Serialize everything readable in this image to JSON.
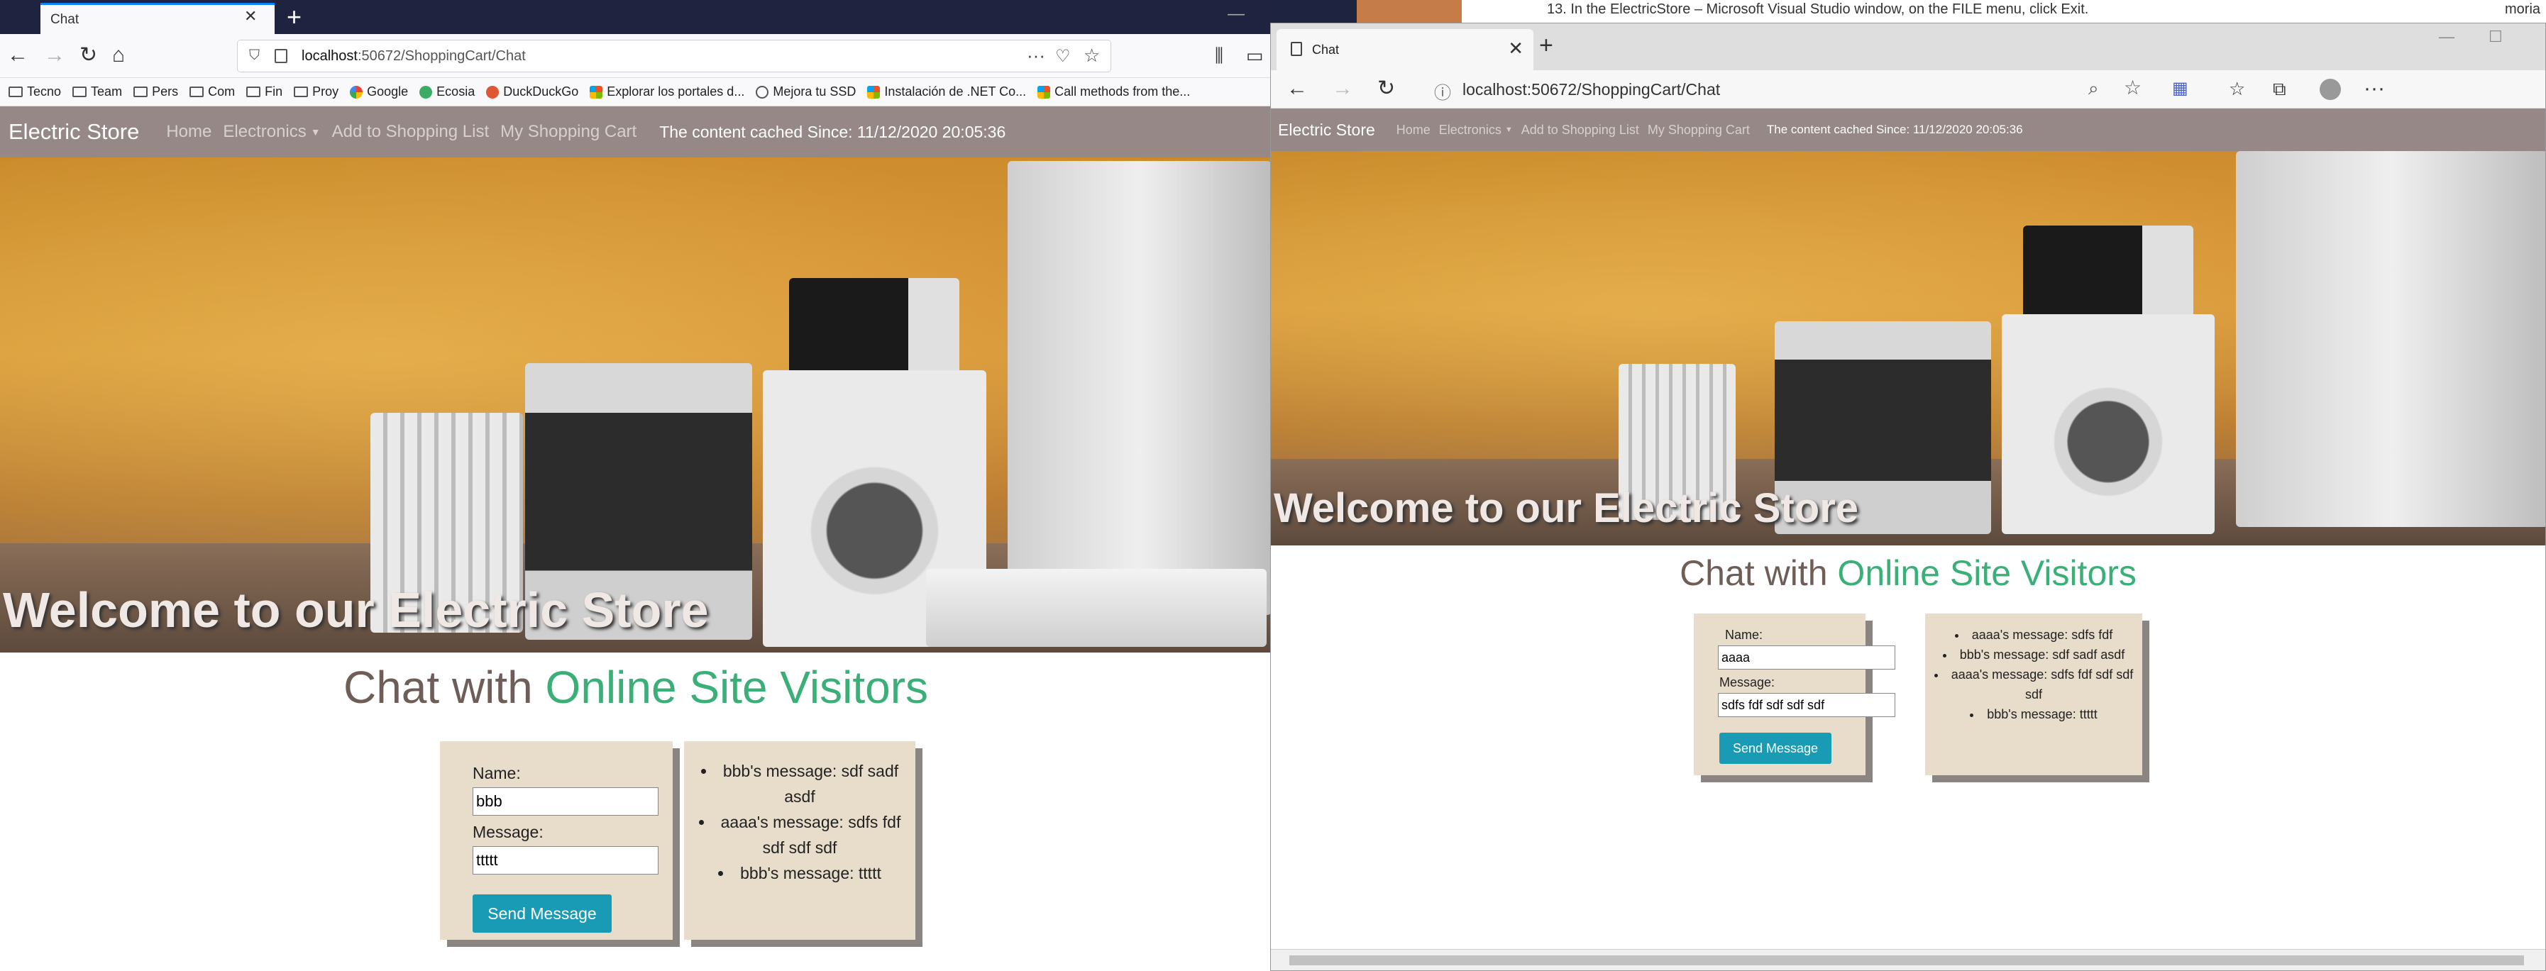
{
  "left": {
    "tab_title": "Chat",
    "url_host": "localhost",
    "url_path": ":50672/ShoppingCart/Chat",
    "bookmarks": [
      "Tecno",
      "Team",
      "Pers",
      "Com",
      "Fin",
      "Proy",
      "Google",
      "Ecosia",
      "DuckDuckGo",
      "Explorar los portales d...",
      "Mejora tu SSD",
      "Instalación de .NET Co...",
      "Call methods from the..."
    ],
    "site": {
      "brand": "Electric Store",
      "nav": [
        "Home",
        "Electronics",
        "Add to Shopping List",
        "My Shopping Cart"
      ],
      "cached": "The content cached Since: 11/12/2020 20:05:36",
      "welcome": "Welcome to our Electric Store",
      "chat_title_a": "Chat with",
      "chat_title_b": "Online Site Visitors",
      "name_label": "Name:",
      "name_value": "bbb",
      "message_label": "Message:",
      "message_value": "ttttt",
      "send_label": "Send Message",
      "messages": [
        "bbb's message: sdf sadf asdf",
        "aaaa's message: sdfs fdf sdf sdf sdf",
        "bbb's message: ttttt"
      ]
    }
  },
  "right": {
    "tab_title": "Chat",
    "url": "localhost:50672/ShoppingCart/Chat",
    "site": {
      "brand": "Electric Store",
      "nav": [
        "Home",
        "Electronics",
        "Add to Shopping List",
        "My Shopping Cart"
      ],
      "cached": "The content cached Since: 11/12/2020 20:05:36",
      "welcome": "Welcome to our Electric Store",
      "chat_title_a": "Chat with",
      "chat_title_b": "Online Site Visitors",
      "name_label": "Name:",
      "name_value": "aaaa",
      "message_label": "Message:",
      "message_value": "sdfs fdf sdf sdf sdf",
      "send_label": "Send Message",
      "messages": [
        "aaaa's message: sdfs fdf",
        "bbb's message: sdf sadf asdf",
        "aaaa's message: sdfs fdf sdf sdf sdf",
        "bbb's message: ttttt"
      ]
    }
  },
  "background_doc": {
    "text": "13. In the ElectricStore – Microsoft Visual Studio window, on the FILE menu, click Exit.",
    "corner_text": "moria"
  },
  "colors": {
    "navbar": "#958886",
    "accent_green": "#3aaf78",
    "button": "#1a9bb5",
    "card": "#e8dccb"
  }
}
